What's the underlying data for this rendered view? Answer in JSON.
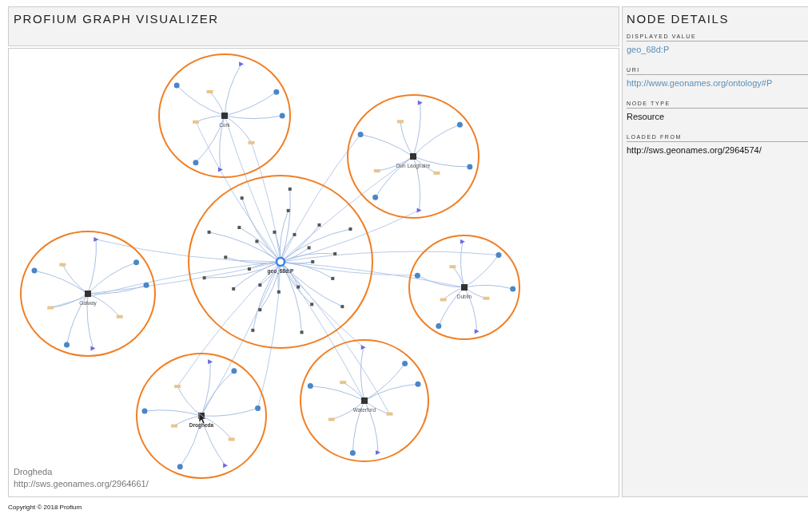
{
  "header": {
    "title": "PROFIUM GRAPH VISUALIZER"
  },
  "graph": {
    "nodes": [
      {
        "label": "Cork",
        "kind": "cluster",
        "selected": false,
        "hovered": false
      },
      {
        "label": "Dun Laoghaire",
        "kind": "cluster",
        "selected": false,
        "hovered": false
      },
      {
        "label": "geo_68d:P",
        "kind": "center",
        "selected": true,
        "hovered": false
      },
      {
        "label": "Galway",
        "kind": "cluster",
        "selected": false,
        "hovered": false
      },
      {
        "label": "Dublin",
        "kind": "cluster",
        "selected": false,
        "hovered": false
      },
      {
        "label": "Drogheda",
        "kind": "cluster",
        "selected": false,
        "hovered": true
      },
      {
        "label": "Waterford",
        "kind": "cluster",
        "selected": false,
        "hovered": false
      }
    ],
    "hover_info": {
      "label": "Drogheda",
      "uri": "http://sws.geonames.org/2964661/"
    }
  },
  "details": {
    "title": "NODE DETAILS",
    "fields": [
      {
        "label": "DISPLAYED VALUE",
        "value": "geo_68d:P",
        "kind": "link"
      },
      {
        "label": "URI",
        "value": "http://www.geonames.org/ontology#P",
        "kind": "link"
      },
      {
        "label": "NODE TYPE",
        "value": "Resource",
        "kind": "plain"
      },
      {
        "label": "LOADED FROM",
        "value": "http://sws.geonames.org/2964574/",
        "kind": "plain"
      }
    ]
  },
  "footer": "Copyright © 2018 Profium"
}
